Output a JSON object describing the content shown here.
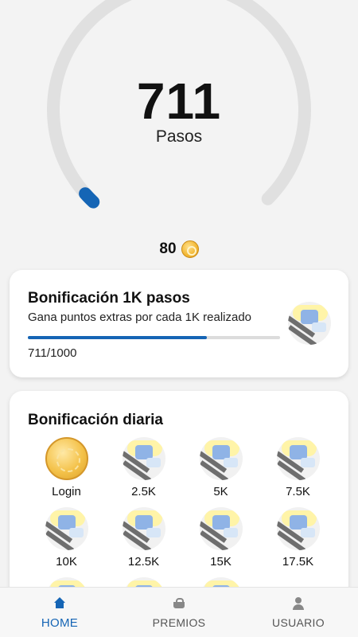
{
  "gauge": {
    "steps": "711",
    "unit": "Pasos",
    "progress": 0.0,
    "track_color": "#e0e0e0",
    "indicator_color": "#1565b5"
  },
  "points": {
    "value": "80",
    "icon": "coin-icon"
  },
  "bonus_1k": {
    "title": "Bonificación 1K pasos",
    "subtitle": "Gana puntos extras por cada 1K realizado",
    "progress_text": "711/1000",
    "progress_fraction": 0.711,
    "badge_icon": "street-badge-icon"
  },
  "daily": {
    "title": "Bonificación diaria",
    "items": [
      {
        "label": "Login",
        "icon": "gold-coin-icon"
      },
      {
        "label": "2.5K",
        "icon": "street-badge-icon"
      },
      {
        "label": "5K",
        "icon": "street-badge-icon"
      },
      {
        "label": "7.5K",
        "icon": "street-badge-icon"
      },
      {
        "label": "10K",
        "icon": "street-badge-icon"
      },
      {
        "label": "12.5K",
        "icon": "street-badge-icon"
      },
      {
        "label": "15K",
        "icon": "street-badge-icon"
      },
      {
        "label": "17.5K",
        "icon": "street-badge-icon"
      },
      {
        "label": "",
        "icon": "street-badge-icon"
      },
      {
        "label": "",
        "icon": "street-badge-icon"
      },
      {
        "label": "",
        "icon": "street-badge-icon"
      }
    ]
  },
  "nav": {
    "items": [
      {
        "label": "HOME",
        "icon": "home-icon",
        "active": true
      },
      {
        "label": "PREMIOS",
        "icon": "basket-icon",
        "active": false
      },
      {
        "label": "USUARIO",
        "icon": "user-icon",
        "active": false
      }
    ]
  },
  "colors": {
    "accent": "#1565b5",
    "background": "#f3f3f3"
  }
}
